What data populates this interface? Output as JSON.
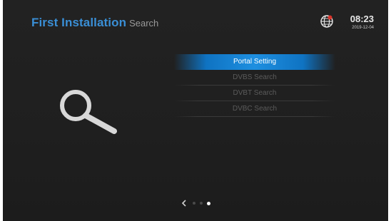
{
  "header": {
    "title": "First Installation",
    "subtitle": "Search"
  },
  "clock": {
    "time": "08:23",
    "date": "2019-12-04",
    "icon": "globe-icon"
  },
  "left_icon": "search-icon",
  "menu": {
    "items": [
      {
        "label": "Portal Setting",
        "active": true
      },
      {
        "label": "DVBS Search",
        "active": false
      },
      {
        "label": "DVBT Search",
        "active": false
      },
      {
        "label": "DVBC Search",
        "active": false
      }
    ]
  },
  "pager": {
    "page_count": 3,
    "current_page": 3,
    "prev_icon": "chevron-left-icon"
  },
  "colors": {
    "accent": "#3a8fd6",
    "selection": "#1e8fe0",
    "background": "#202020"
  }
}
